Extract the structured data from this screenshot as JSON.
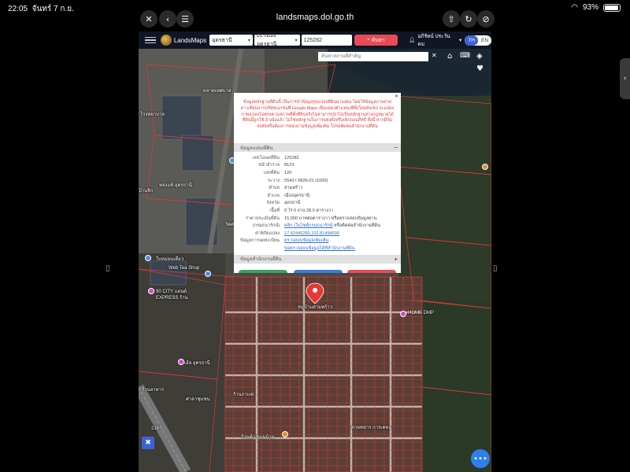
{
  "status_bar": {
    "time": "22:05",
    "date": "จันทร์ 7 ก.ย.",
    "battery": "93%",
    "battery_level": 0.93
  },
  "browser": {
    "url": "landsmaps.dol.go.th"
  },
  "app": {
    "brand": "LandsMaps",
    "province": "อุดรธานี",
    "district": "01-เมืองอุดรธานี",
    "parcel_no": "125282",
    "search_label": "ค้นหา",
    "user_name": "อภิรัตน์ ประวันคม",
    "lang_th": "TH",
    "lang_en": "EN",
    "place_search_placeholder": "ค้นหาสถานที่สำคัญ"
  },
  "popup": {
    "disclaimer": "ข้อมูลหลักฐานที่ดินนี้ เป็นการนำข้อมูลรูปแปลงที่ดินมาแสดง โดยใช้ข้อมูลภาพถ่ายดาวเทียมจากบริษัทเอกชนที่ Google Maps เพื่อแสดงตำแหน่งที่ตั้งโดยสังเขป จะแสดงภาพแปลงไม่ตรงตามสภาพที่ตั้งที่ดินจริงไม่สามารถนำไปเป็นหลักฐานทางกฎหมายได้ ที่ดินนี้ถูกใช้ อ้างอิงแล้ว ไม่ใช่หลักฐานในการแต่งตั้งหรือเพิกถอนสิทธิ์ ทั้งนี้ หากมีข้อสงสัยหรือต้องการสอบถามข้อมูลเพิ่มเติม โปรดติดต่อสำนักงานที่ดิน",
    "section1": "ข้อมูลแปลงที่ดิน",
    "section2": "ข้อมูลสำนักงานที่ดิน",
    "rows": [
      {
        "label": "เลขโฉนดที่ดิน",
        "value": "125282"
      },
      {
        "label": "หน้าสำรวจ",
        "value": "8123"
      },
      {
        "label": "เลขที่ดิน",
        "value": "120"
      },
      {
        "label": "ระวาง",
        "value": "5543 I 6826-01 (1000)"
      },
      {
        "label": "ตำบล",
        "value": "สามพร้าว"
      },
      {
        "label": "อำเภอ",
        "value": "เมืองอุดรธานี"
      },
      {
        "label": "จังหวัด",
        "value": "อุดรธานี"
      },
      {
        "label": "เนื้อที่",
        "value": "0 ไร่ 0 งาน 28.0 ตารางวา"
      },
      {
        "label": "ราคาประเมินที่ดิน",
        "value": "15,000 บาทต่อตารางวา หรือตรวจสอบข้อมูลผ่าน"
      },
      {
        "label": "(กรมธนารักษ์)",
        "value_link": "คลิก เว็บไซต์กรมธนารักษ์",
        "value_rest": " หรือติดต่อสำนักงานที่ดิน"
      },
      {
        "label": "ค่าพิกัดแปลง",
        "value": "17.42445260,102.81494690",
        "link": true
      },
      {
        "label": "ข้อมูลการจดทะเบียน",
        "value": "ตรวจสอบข้อมูลเพิ่มเติม",
        "link": true
      },
      {
        "label": "",
        "value": "ขอตรวจสอบข้อมูลได้ที่สำนักงานที่ดิน",
        "link": true
      }
    ]
  },
  "map": {
    "labels": [
      {
        "text": "ตลาดเทศบาล"
      },
      {
        "text": "โรงพยาบาล"
      },
      {
        "text": "ทองแท้ อุดรธานี"
      },
      {
        "text": "บ้านจิก"
      },
      {
        "text": "วัดศรีเมือง"
      },
      {
        "text": "ใบหม่อนเดี่ยว"
      },
      {
        "text": "Web Tea Shop"
      },
      {
        "text": "90 CITY แอนด์"
      },
      {
        "text": "EXPRESS ร้าน"
      },
      {
        "text": "หมู่บ้านสามพร้าว"
      },
      {
        "text": "HOME DMP"
      },
      {
        "text": "เฮ้ย อุดรธานี"
      },
      {
        "text": "ร้านกาแฟ"
      },
      {
        "text": "ร้านอาหาร"
      },
      {
        "text": "ศาลาชุมชน"
      },
      {
        "text": "ร้านค้า ถนนบ้าน"
      },
      {
        "text": "ค่ายทหาร การเคหะ"
      },
      {
        "text": "216"
      }
    ]
  },
  "colors": {
    "accent": "#2f80ed",
    "search_btn": "#e84b55",
    "parcel_line": "#e43a36",
    "header": "#101623",
    "lang_active": "#3a63d6"
  }
}
